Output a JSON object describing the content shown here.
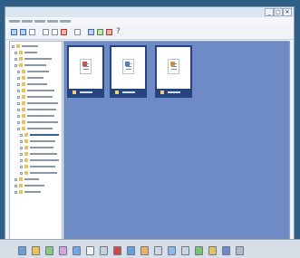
{
  "window": {
    "controls": [
      "_",
      "□",
      "✕"
    ]
  },
  "toolbar": {
    "help_glyph": "?"
  },
  "icons": {
    "toolbar": [
      "back-icon",
      "forward-icon",
      "up-icon",
      "copy-icon",
      "paste-icon",
      "delete-icon",
      "properties-icon",
      "search-icon",
      "refresh-icon",
      "stop-icon",
      "help-icon"
    ],
    "taskbar": [
      "start-icon",
      "folder-icon",
      "image-icon",
      "music-icon",
      "web-icon",
      "mail-icon",
      "settings-icon",
      "chat-icon",
      "globe-icon",
      "tools-icon",
      "camera-icon",
      "media-icon",
      "note-icon",
      "game-icon",
      "clock-icon",
      "volume-icon",
      "network-icon"
    ]
  },
  "colors": {
    "content_background": "#6f8bc6",
    "thumbnail_border": "#26447f"
  }
}
